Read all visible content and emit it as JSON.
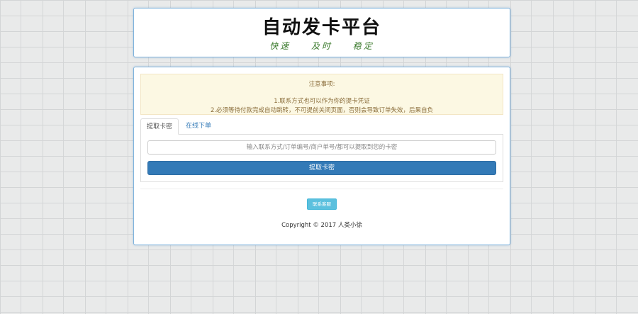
{
  "header": {
    "title": "自动发卡平台",
    "subtitle": "快速 及时 稳定"
  },
  "notice": {
    "title": "注意事项:",
    "line1": "1.联系方式也可以作为你的提卡凭证",
    "line2": "2.必须等待付款完成自动跳转，不可提前关闭页面，否则会导致订单失效，后果自负"
  },
  "tabs": [
    {
      "label": "提取卡密",
      "active": true
    },
    {
      "label": "在线下单",
      "active": false
    }
  ],
  "form": {
    "search_placeholder": "输入联系方式/订单编号/商户单号/都可以提取到您的卡密",
    "submit_label": "提取卡密"
  },
  "footer": {
    "contact_label": "联系客服",
    "copyright": "Copyright © 2017  人类小徐"
  },
  "colors": {
    "primary": "#337ab7",
    "info": "#5bc0de",
    "notice_bg": "#fcf8e3",
    "notice_text": "#8a6d3b",
    "subtitle": "#3a7a2c",
    "panel_border": "#7fb3dd"
  }
}
